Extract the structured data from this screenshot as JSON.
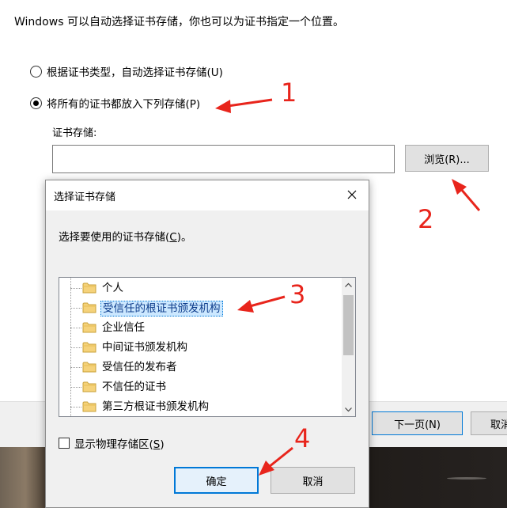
{
  "wizard": {
    "intro": "Windows 可以自动选择证书存储，你也可以为证书指定一个位置。",
    "options": [
      {
        "label": "根据证书类型，自动选择证书存储(U)",
        "checked": false
      },
      {
        "label": "将所有的证书都放入下列存储(P)",
        "checked": true
      }
    ],
    "store_label": "证书存储:",
    "store_value": "",
    "browse_label": "浏览(R)...",
    "next_label": "下一页(N)",
    "cancel_label": "取消"
  },
  "dialog": {
    "title": "选择证书存储",
    "prompt_before": "选择要使用的证书存储(",
    "prompt_key": "C",
    "prompt_after": ")。",
    "stores": [
      {
        "label": "个人",
        "selected": false
      },
      {
        "label": "受信任的根证书颁发机构",
        "selected": true
      },
      {
        "label": "企业信任",
        "selected": false
      },
      {
        "label": "中间证书颁发机构",
        "selected": false
      },
      {
        "label": "受信任的发布者",
        "selected": false
      },
      {
        "label": "不信任的证书",
        "selected": false
      },
      {
        "label": "第三方根证书颁发机构",
        "selected": false
      }
    ],
    "show_physical_before": "显示物理存储区(",
    "show_physical_key": "S",
    "show_physical_after": ")",
    "show_physical_checked": false,
    "ok_label": "确定",
    "cancel_label": "取消"
  },
  "annotations": {
    "color": "#e8251c",
    "labels": [
      "1",
      "2",
      "3",
      "4"
    ]
  },
  "colors": {
    "selection": "#cce8ff",
    "focus": "#0078d7",
    "folder": "#f5d27a"
  }
}
